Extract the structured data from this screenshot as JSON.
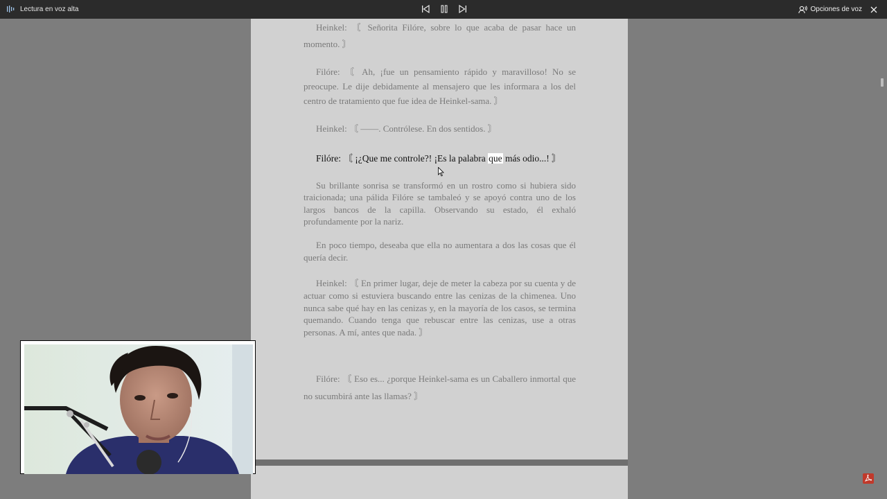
{
  "toolbar": {
    "title": "Lectura en voz alta",
    "voice_options_label": "Opciones de voz",
    "icons": {
      "read_aloud": "read-aloud-icon",
      "previous": "previous-paragraph-icon",
      "pause": "pause-icon",
      "next": "next-paragraph-icon",
      "voice": "voice-options-icon",
      "close": "close-icon"
    }
  },
  "document": {
    "paragraphs": [
      "Heinkel: 〘 Señorita Filóre, sobre lo que acaba de pasar hace un momento. 〙",
      "Filóre: 〘 Ah, ¡fue un pensamiento rápido y maravilloso! No se preocupe. Le dije debidamente al mensajero que les informara a los del centro de tratamiento que fue idea de Heinkel-sama. 〙",
      "Heinkel: 〘 ——. Contrólese. En dos sentidos. 〙",
      "Su brillante sonrisa se transformó en un rostro como si hubiera sido traicionada; una pálida Filóre se tambaleó y se apoyó contra uno de los largos bancos de la capilla. Observando su estado, él exhaló profundamente por la nariz.",
      "En poco tiempo, deseaba que ella no aumentara a dos las cosas que él quería decir.",
      "Heinkel: 〘 En primer lugar, deje de meter la cabeza por su cuenta y de actuar como si estuviera buscando entre las cenizas de la chimenea. Uno nunca sabe qué hay en las cenizas y, en la mayoría de los casos, se termina quemando. Cuando tenga que rebuscar entre las cenizas, use a otras personas. A mí, antes que nada. 〙",
      "Filóre: 〘 Eso es... ¿porque Heinkel-sama es un Caballero inmortal que no sucumbirá ante las llamas? 〙"
    ],
    "active_paragraph": {
      "before": "Filóre: 〘 ¡¿Que me controle?! ¡Es la palabra ",
      "highlighted_word": "que",
      "after": " más odio...! 〙"
    }
  },
  "colors": {
    "toolbar_bg": "#2b2b2b",
    "page_bg": "#d1d1d1",
    "dimmed_text": "#7a7a7a",
    "active_text": "#111111",
    "highlight": "#ffffff",
    "pdf_icon": "#c0392b"
  },
  "misc_icons": [
    "pdf-icon",
    "mouse-cursor-icon"
  ]
}
